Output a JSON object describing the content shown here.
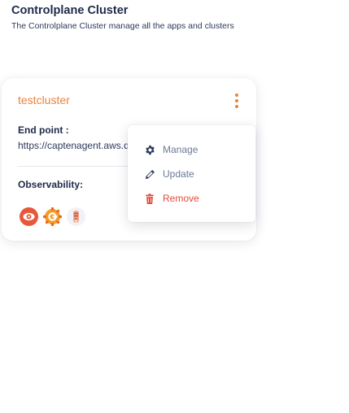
{
  "header": {
    "title": "Controlplane Cluster",
    "subtitle": "The Controlplane Cluster manage all the apps and clusters"
  },
  "cluster_card": {
    "name": "testcluster",
    "endpoint_label": "End point :",
    "endpoint_value": "https://captenagent.aws.dev.optimizor.app",
    "observability_label": "Observability:",
    "observability_icons": [
      "prometheus-icon",
      "grafana-icon",
      "signoz-icon"
    ],
    "accent_color": "#e8843a"
  },
  "context_menu": {
    "items": [
      {
        "label": "Manage",
        "icon": "gear-icon",
        "color": "#6b7896"
      },
      {
        "label": "Update",
        "icon": "pencil-icon",
        "color": "#6b7896"
      },
      {
        "label": "Remove",
        "icon": "trash-icon",
        "color": "#e34b3a"
      }
    ]
  }
}
